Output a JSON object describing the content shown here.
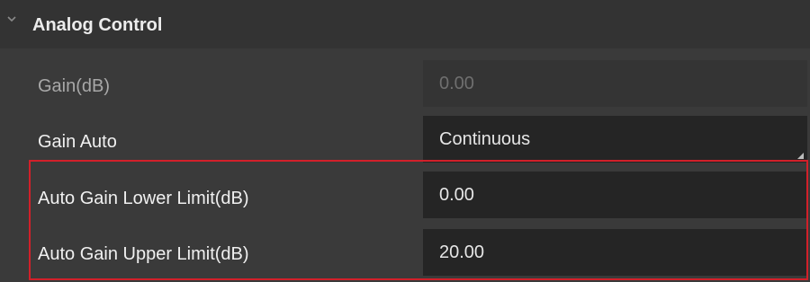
{
  "section": {
    "title": "Analog Control",
    "icon": "chevron-down-icon"
  },
  "rows": [
    {
      "label": "Gain(dB)",
      "value": "0.00",
      "state": "disabled"
    },
    {
      "label": "Gain Auto",
      "value": "Continuous",
      "state": "enabled",
      "control": "select"
    },
    {
      "label": "Auto Gain Lower Limit(dB)",
      "value": "0.00",
      "state": "enabled",
      "highlighted": true
    },
    {
      "label": "Auto Gain Upper Limit(dB)",
      "value": "20.00",
      "state": "enabled",
      "highlighted": true
    }
  ],
  "colors": {
    "panel_background": "#3a3a3a",
    "header_background": "#333333",
    "field_background": "#252525",
    "highlight_border": "#d2202a"
  }
}
